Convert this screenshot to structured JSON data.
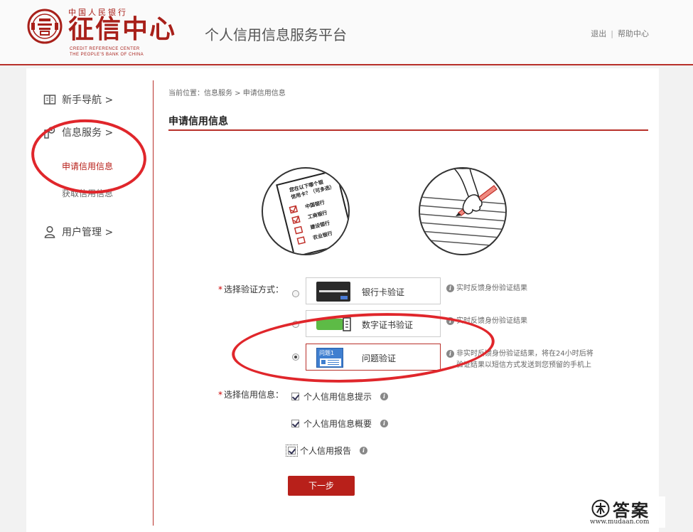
{
  "header": {
    "logo_small_text": "中国人民银行",
    "logo_big_text": "征信中心",
    "logo_en_line1": "CREDIT REFERENCE CENTER",
    "logo_en_line2": "THE PEOPLE'S BANK OF CHINA",
    "site_title": "个人信用信息服务平台",
    "logout_label": "退出",
    "separator": "|",
    "help_label": "帮助中心"
  },
  "sidebar": {
    "items": [
      {
        "label": "新手导航 >",
        "icon": "book-icon"
      },
      {
        "label": "信息服务 >",
        "icon": "key-icon"
      },
      {
        "label": "用户管理 >",
        "icon": "user-icon"
      }
    ],
    "sub_items": [
      {
        "label": "申请信用信息",
        "active": true
      },
      {
        "label": "获取信用信息",
        "active": false
      }
    ]
  },
  "main": {
    "breadcrumb": "当前位置：信息服务 > 申请信用信息",
    "section_title": "申请信用信息",
    "illustration_questionnaire": {
      "line1": "您在以下哪个银",
      "line2": "信用卡？（可多选）",
      "options": [
        "中国银行",
        "工商银行",
        "建设银行",
        "农业银行"
      ]
    },
    "verify_label": "选择验证方式：",
    "verify_options": [
      {
        "label": "银行卡验证",
        "hint": "实时反馈身份验证结果",
        "selected": false,
        "icon": "bank-card-icon"
      },
      {
        "label": "数字证书验证",
        "hint": "实时反馈身份验证结果",
        "selected": false,
        "icon": "digital-certificate-icon"
      },
      {
        "label": "问题验证",
        "icon_text": "问题1",
        "hint_line1": "非实时反馈身份验证结果，将在24小时后将",
        "hint_line2": "验证结果以短信方式发送到您预留的手机上",
        "selected": true,
        "icon": "question-card-icon"
      }
    ],
    "credit_label": "选择信用信息：",
    "credit_options": [
      {
        "label": "个人信用信息提示",
        "checked": true
      },
      {
        "label": "个人信用信息概要",
        "checked": true
      },
      {
        "label": "个人信用报告",
        "checked": true
      }
    ],
    "next_button": "下一步"
  },
  "watermark": {
    "text": "答案",
    "url": "www.mudaan.com"
  },
  "colors": {
    "brand_red": "#b8302a",
    "button_red": "#b8201a",
    "annotation_red": "#e0262b"
  }
}
